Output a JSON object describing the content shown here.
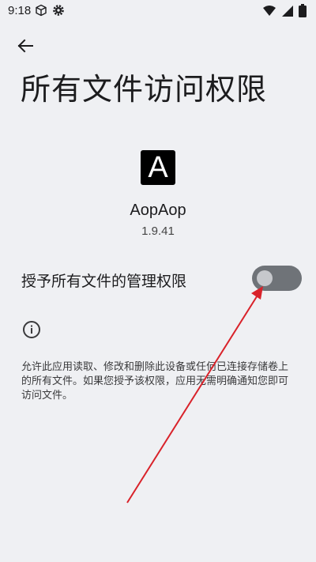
{
  "status_bar": {
    "time": "9:18",
    "left_icons": [
      "cube-icon",
      "settings-icon"
    ],
    "right_icons": [
      "wifi-icon",
      "signal-icon",
      "battery-icon"
    ]
  },
  "header": {
    "back_icon": "arrow-left-icon",
    "title": "所有文件访问权限"
  },
  "app": {
    "icon_letter": "A",
    "name": "AopAop",
    "version": "1.9.41"
  },
  "permission": {
    "label": "授予所有文件的管理权限",
    "enabled": false
  },
  "info": {
    "icon": "info-icon",
    "description": "允许此应用读取、修改和删除此设备或任何已连接存储卷上的所有文件。如果您授予该权限，应用无需明确通知您即可访问文件。"
  },
  "colors": {
    "background": "#eff0f3",
    "toggle_track": "#6f7378",
    "toggle_knob": "#c6c8cc",
    "annotation_arrow": "#d9222a"
  }
}
